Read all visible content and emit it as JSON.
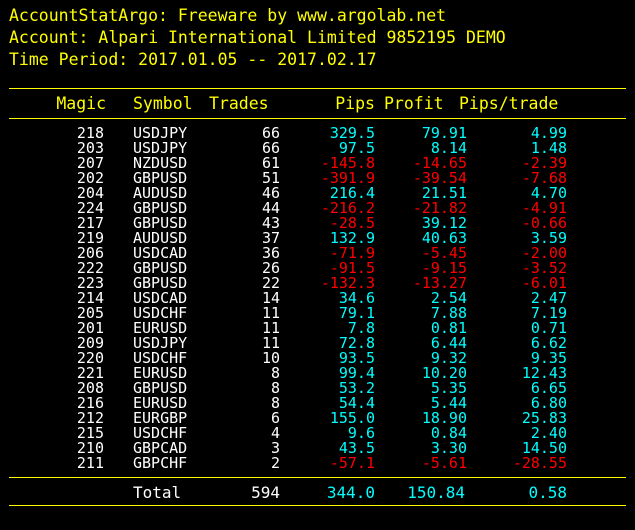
{
  "header": {
    "line1": "AccountStatArgo: Freeware by www.argolab.net",
    "line2": "Account: Alpari International Limited 9852195 DEMO",
    "line3": "Time Period: 2017.01.05 -- 2017.02.17"
  },
  "columns": [
    "Magic",
    "Symbol",
    "Trades",
    "Pips",
    "Profit",
    "Pips/trade"
  ],
  "colors": {
    "header": "#ffff00",
    "text": "#ffffff",
    "positive": "#00ffff",
    "negative": "#ff0000",
    "background": "#000000"
  },
  "rows": [
    {
      "magic": "218",
      "symbol": "USDJPY",
      "trades": "66",
      "pips": "329.5",
      "profit": "79.91",
      "ppt": "4.99"
    },
    {
      "magic": "203",
      "symbol": "USDJPY",
      "trades": "66",
      "pips": "97.5",
      "profit": "8.14",
      "ppt": "1.48"
    },
    {
      "magic": "207",
      "symbol": "NZDUSD",
      "trades": "61",
      "pips": "-145.8",
      "profit": "-14.65",
      "ppt": "-2.39"
    },
    {
      "magic": "202",
      "symbol": "GBPUSD",
      "trades": "51",
      "pips": "-391.9",
      "profit": "-39.54",
      "ppt": "-7.68"
    },
    {
      "magic": "204",
      "symbol": "AUDUSD",
      "trades": "46",
      "pips": "216.4",
      "profit": "21.51",
      "ppt": "4.70"
    },
    {
      "magic": "224",
      "symbol": "GBPUSD",
      "trades": "44",
      "pips": "-216.2",
      "profit": "-21.82",
      "ppt": "-4.91"
    },
    {
      "magic": "217",
      "symbol": "GBPUSD",
      "trades": "43",
      "pips": "-28.5",
      "profit": "39.12",
      "ppt": "-0.66"
    },
    {
      "magic": "219",
      "symbol": "AUDUSD",
      "trades": "37",
      "pips": "132.9",
      "profit": "40.63",
      "ppt": "3.59"
    },
    {
      "magic": "206",
      "symbol": "USDCAD",
      "trades": "36",
      "pips": "-71.9",
      "profit": "-5.45",
      "ppt": "-2.00"
    },
    {
      "magic": "222",
      "symbol": "GBPUSD",
      "trades": "26",
      "pips": "-91.5",
      "profit": "-9.15",
      "ppt": "-3.52"
    },
    {
      "magic": "223",
      "symbol": "GBPUSD",
      "trades": "22",
      "pips": "-132.3",
      "profit": "-13.27",
      "ppt": "-6.01"
    },
    {
      "magic": "214",
      "symbol": "USDCAD",
      "trades": "14",
      "pips": "34.6",
      "profit": "2.54",
      "ppt": "2.47"
    },
    {
      "magic": "205",
      "symbol": "USDCHF",
      "trades": "11",
      "pips": "79.1",
      "profit": "7.88",
      "ppt": "7.19"
    },
    {
      "magic": "201",
      "symbol": "EURUSD",
      "trades": "11",
      "pips": "7.8",
      "profit": "0.81",
      "ppt": "0.71"
    },
    {
      "magic": "209",
      "symbol": "USDJPY",
      "trades": "11",
      "pips": "72.8",
      "profit": "6.44",
      "ppt": "6.62"
    },
    {
      "magic": "220",
      "symbol": "USDCHF",
      "trades": "10",
      "pips": "93.5",
      "profit": "9.32",
      "ppt": "9.35"
    },
    {
      "magic": "221",
      "symbol": "EURUSD",
      "trades": "8",
      "pips": "99.4",
      "profit": "10.20",
      "ppt": "12.43"
    },
    {
      "magic": "208",
      "symbol": "GBPUSD",
      "trades": "8",
      "pips": "53.2",
      "profit": "5.35",
      "ppt": "6.65"
    },
    {
      "magic": "216",
      "symbol": "EURUSD",
      "trades": "8",
      "pips": "54.4",
      "profit": "5.44",
      "ppt": "6.80"
    },
    {
      "magic": "212",
      "symbol": "EURGBP",
      "trades": "6",
      "pips": "155.0",
      "profit": "18.90",
      "ppt": "25.83"
    },
    {
      "magic": "215",
      "symbol": "USDCHF",
      "trades": "4",
      "pips": "9.6",
      "profit": "0.84",
      "ppt": "2.40"
    },
    {
      "magic": "210",
      "symbol": "GBPCAD",
      "trades": "3",
      "pips": "43.5",
      "profit": "3.30",
      "ppt": "14.50"
    },
    {
      "magic": "211",
      "symbol": "GBPCHF",
      "trades": "2",
      "pips": "-57.1",
      "profit": "-5.61",
      "ppt": "-28.55"
    }
  ],
  "total": {
    "label": "Total",
    "trades": "594",
    "pips": "344.0",
    "profit": "150.84",
    "ppt": "0.58"
  }
}
